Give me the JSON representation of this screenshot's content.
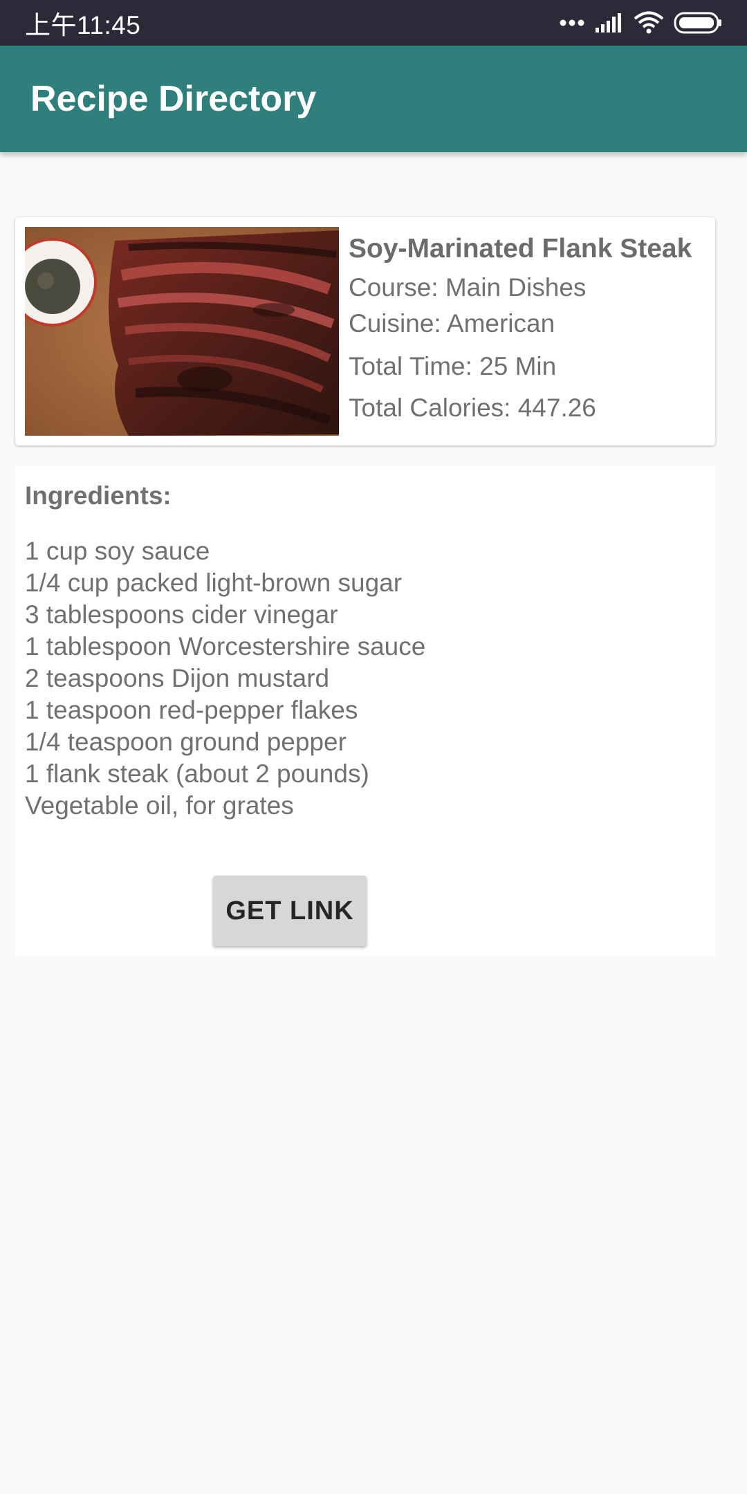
{
  "status_bar": {
    "time": "上午11:45",
    "icons": [
      "more-dots-icon",
      "signal-icon",
      "wifi-icon",
      "battery-icon"
    ]
  },
  "app_bar": {
    "title": "Recipe Directory",
    "color": "#2f7f7c"
  },
  "recipe": {
    "image": "flank-steak-photo",
    "title": "Soy-Marinated Flank Steak",
    "course": "Course: Main Dishes",
    "cuisine": "Cuisine: American",
    "total_time": "Total Time: 25 Min",
    "total_calories": "Total Calories: 447.26"
  },
  "ingredients": {
    "heading": "Ingredients:",
    "items": [
      "1 cup soy sauce",
      "1/4 cup packed light-brown sugar",
      "3 tablespoons cider vinegar",
      "1 tablespoon Worcestershire sauce",
      "2 teaspoons Dijon mustard",
      "1 teaspoon red-pepper flakes",
      "1/4 teaspoon ground pepper",
      "1 flank steak (about 2 pounds)",
      "Vegetable oil, for grates"
    ]
  },
  "actions": {
    "get_link_label": "GET LINK"
  }
}
